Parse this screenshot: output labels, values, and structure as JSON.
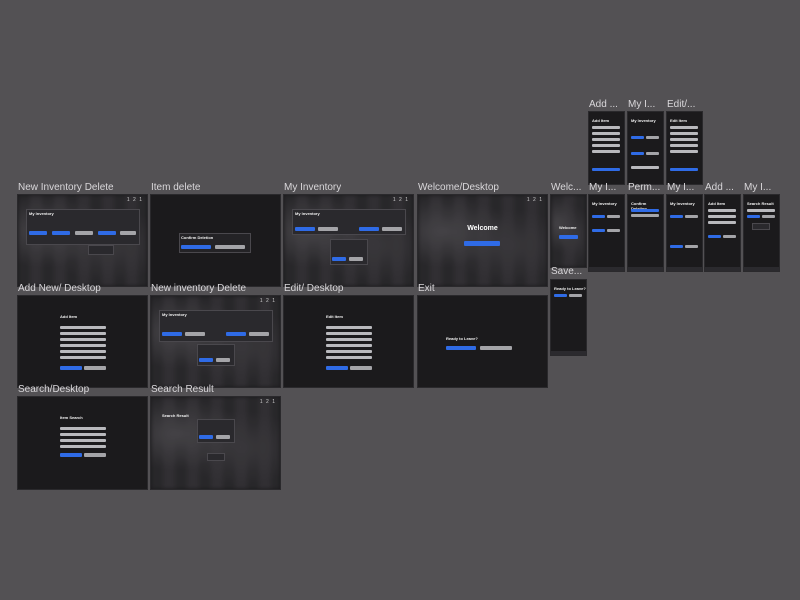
{
  "frames": [
    {
      "label": "New Inventory Delete"
    },
    {
      "label": "Item delete"
    },
    {
      "label": "My Inventory"
    },
    {
      "label": "Welcome/Desktop"
    },
    {
      "label": "Welc..."
    },
    {
      "label": "Add New/ Desktop"
    },
    {
      "label": "New inventory Delete"
    },
    {
      "label": "Edit/ Desktop"
    },
    {
      "label": "Exit"
    },
    {
      "label": "Save..."
    },
    {
      "label": "Search/Desktop"
    },
    {
      "label": "Search Result"
    },
    {
      "label": "Add ..."
    },
    {
      "label": "My I..."
    },
    {
      "label": "Edit/..."
    },
    {
      "label": "My I..."
    },
    {
      "label": "Perm..."
    },
    {
      "label": "My I..."
    },
    {
      "label": "Add ..."
    },
    {
      "label": "My I..."
    }
  ],
  "content": {
    "welcome_title": "Welcome",
    "my_inventory_title": "My Inventory",
    "add_item_title": "Add Item",
    "edit_item_title": "Edit Item",
    "confirm_deletion_title": "Confirm Deletion",
    "ready_to_leave_title": "Ready to Leave?",
    "item_search_title": "Item Search",
    "search_result_title": "Search Result",
    "status_dots": "1 2 1"
  }
}
